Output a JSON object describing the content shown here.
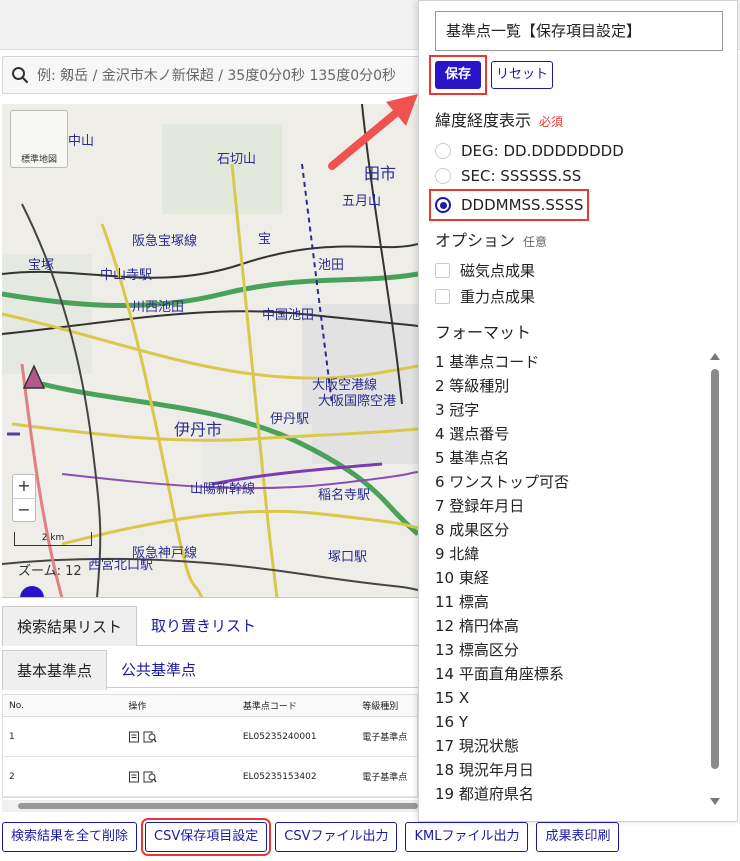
{
  "search": {
    "placeholder": "例: 剱岳 / 金沢市木ノ新保超 / 35度0分0秒 135度0分0秒"
  },
  "map": {
    "thumbnail_label": "標準地図",
    "zoom_in": "+",
    "zoom_out": "−",
    "scale_label": "2 km",
    "zoom_text": "ズーム: 12",
    "place_labels": [
      "中山",
      "石切山",
      "市",
      "阪急宝塚線",
      "中山寺駅",
      "宝塚",
      "川西池田",
      "宝",
      "中国池田",
      "池田",
      "五月山",
      "田市",
      "大阪空港線",
      "大阪国際空港",
      "伊丹市",
      "伊丹駅",
      "山陽新幹線",
      "稲名寺駅",
      "阪急神戸線",
      "西宮北口駅",
      "塚口駅",
      "171",
      "176",
      "E1"
    ]
  },
  "result_tabs": [
    {
      "label": "検索結果リスト"
    },
    {
      "label": "取り置きリスト"
    }
  ],
  "type_tabs": [
    {
      "label": "基本基準点"
    },
    {
      "label": "公共基準点"
    }
  ],
  "table": {
    "headers": [
      "No.",
      "操作",
      "基準点コード",
      "等級種別"
    ],
    "rows": [
      {
        "no": "1",
        "code": "EL05235240001",
        "grade": "電子基準点"
      },
      {
        "no": "2",
        "code": "EL05235153402",
        "grade": "電子基準点"
      }
    ]
  },
  "bottom_buttons": {
    "delete_all": "検索結果を全て削除",
    "csv_settings": "CSV保存項目設定",
    "csv_export": "CSVファイル出力",
    "kml_export": "KMLファイル出力",
    "print": "成果表印刷"
  },
  "panel": {
    "title": "基準点一覧【保存項目設定】",
    "save_label": "保存",
    "reset_label": "リセット",
    "latlon_section": "緯度経度表示",
    "required": "必須",
    "latlon_options": [
      {
        "label": "DEG: DD.DDDDDDDD",
        "checked": false
      },
      {
        "label": "SEC: SSSSSS.SS",
        "checked": false
      },
      {
        "label": "DDDMMSS.SSSS",
        "checked": true
      }
    ],
    "options_section": "オプション",
    "optional": "任意",
    "options": [
      {
        "label": "磁気点成果",
        "checked": false
      },
      {
        "label": "重力点成果",
        "checked": false
      }
    ],
    "format_section": "フォーマット",
    "format_items": [
      "1 基準点コード",
      "2 等級種別",
      "3 冠字",
      "4 選点番号",
      "5 基準点名",
      "6 ワンストップ可否",
      "7 登録年月日",
      "8 成果区分",
      "9 北緯",
      "10 東経",
      "11 標高",
      "12 楕円体高",
      "13 標高区分",
      "14 平面直角座標系",
      "15 X",
      "16 Y",
      "17 現況状態",
      "18 現況年月日",
      "19 都道府県名"
    ]
  },
  "colors": {
    "accent": "#2a14c8",
    "link": "#1a1aa6",
    "highlight": "#e53935",
    "required": "#e53935"
  }
}
